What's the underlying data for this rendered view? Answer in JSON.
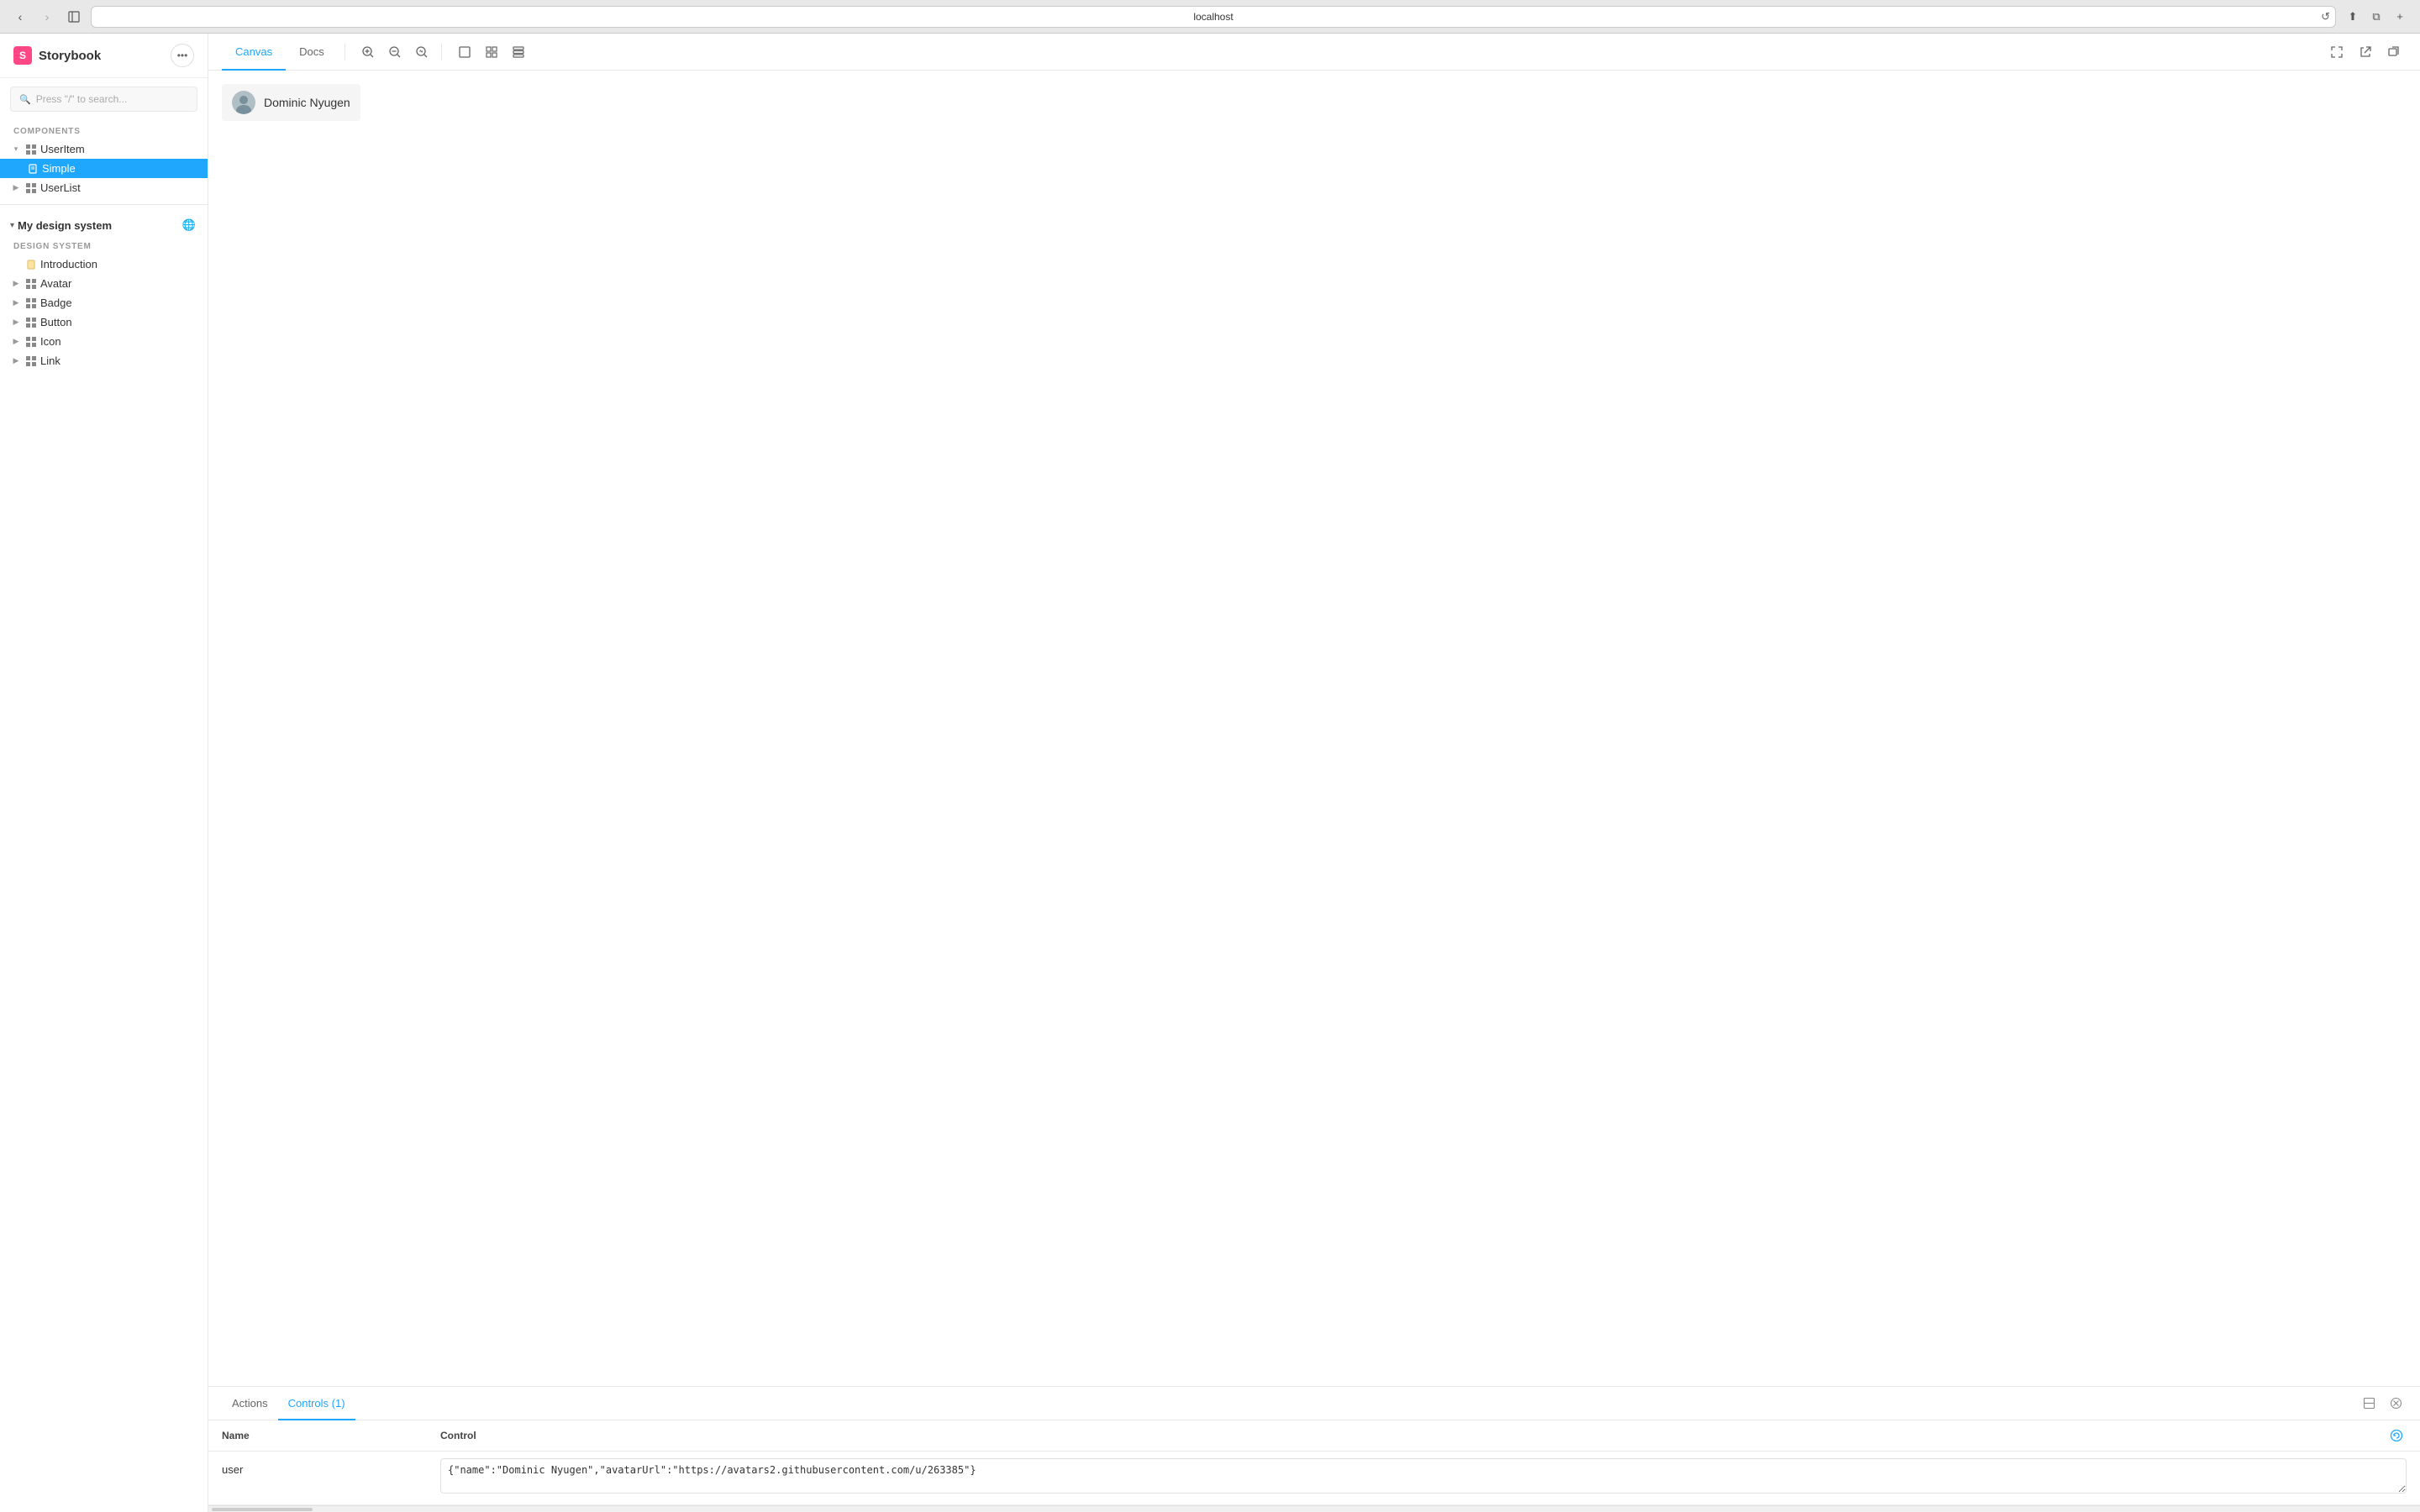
{
  "browser": {
    "url": "localhost",
    "back_disabled": false,
    "forward_disabled": true
  },
  "sidebar": {
    "logo_letter": "S",
    "logo_text": "Storybook",
    "search_placeholder": "Press \"/\" to search...",
    "components_label": "COMPONENTS",
    "components": [
      {
        "id": "user-item",
        "label": "UserItem",
        "expanded": true,
        "has_children": true
      },
      {
        "id": "simple",
        "label": "Simple",
        "active": true,
        "child": true
      },
      {
        "id": "user-list",
        "label": "UserList",
        "expanded": false,
        "has_children": true
      }
    ],
    "design_system_name": "My design system",
    "design_system_label": "DESIGN SYSTEM",
    "design_system_items": [
      {
        "id": "introduction",
        "label": "Introduction",
        "icon": "doc",
        "icon_color": "orange"
      },
      {
        "id": "avatar",
        "label": "Avatar",
        "icon": "grid"
      },
      {
        "id": "badge",
        "label": "Badge",
        "icon": "grid"
      },
      {
        "id": "button",
        "label": "Button",
        "icon": "grid"
      },
      {
        "id": "icon",
        "label": "Icon",
        "icon": "grid"
      },
      {
        "id": "link",
        "label": "Link",
        "icon": "grid"
      }
    ]
  },
  "toolbar": {
    "tabs": [
      {
        "id": "canvas",
        "label": "Canvas",
        "active": true
      },
      {
        "id": "docs",
        "label": "Docs",
        "active": false
      }
    ],
    "zoom_in_title": "Zoom in",
    "zoom_out_title": "Zoom out",
    "zoom_reset_title": "Reset zoom",
    "view_single_title": "Single",
    "view_grid_title": "Grid",
    "view_list_title": "List",
    "fullscreen_title": "Fullscreen",
    "open_new_title": "Open in new tab",
    "copy_link_title": "Copy link"
  },
  "preview": {
    "user_name": "Dominic Nyugen",
    "avatar_url": "https://avatars2.githubusercontent.com/u/263385"
  },
  "bottom_panel": {
    "tabs": [
      {
        "id": "actions",
        "label": "Actions",
        "active": false
      },
      {
        "id": "controls",
        "label": "Controls (1)",
        "active": true
      }
    ],
    "controls_columns": {
      "name": "Name",
      "control": "Control"
    },
    "controls_rows": [
      {
        "name": "user",
        "value": "{\"name\":\"Dominic Nyugen\",\"avatarUrl\":\"https://avatars2.githubusercontent.com/u/263385\"}"
      }
    ]
  }
}
